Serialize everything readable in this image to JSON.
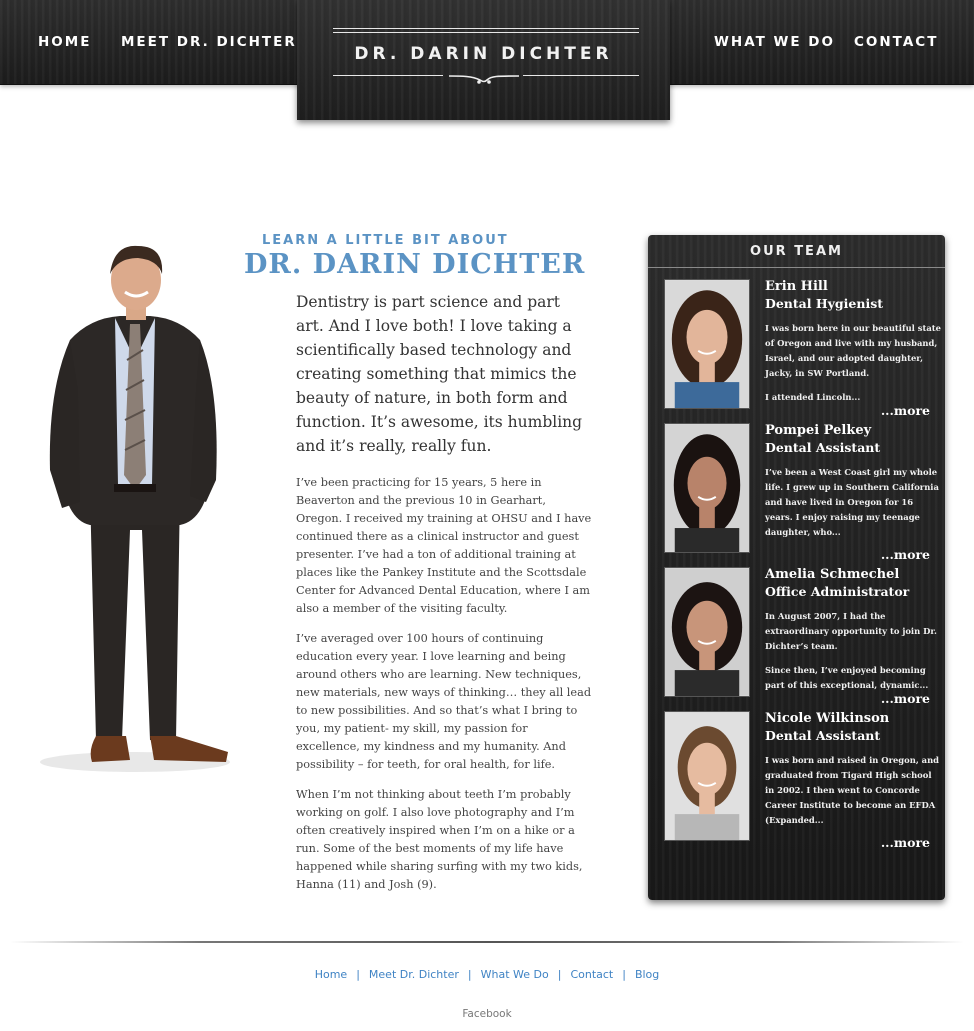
{
  "nav": {
    "home": "HOME",
    "meet": "MEET DR. DICHTER",
    "what": "WHAT WE DO",
    "contact": "CONTACT"
  },
  "logo": {
    "text": "DR. DARIN DICHTER"
  },
  "intro": {
    "eyebrow": "LEARN A LITTLE BIT ABOUT",
    "title": "DR. DARIN DICHTER",
    "lead": "Dentistry is part science and part art. And I love both! I love taking a scientifically based technology and creating something that mimics the beauty of nature, in both form and function. It’s awesome, its humbling and it’s really, really fun.",
    "paragraphs": [
      "I’ve been practicing for 15 years, 5 here in Beaverton and the previous 10 in Gearhart, Oregon. I received my training at OHSU and I have continued there as a clinical instructor and guest presenter. I’ve had a ton of additional training at places like the Pankey Institute and the Scottsdale Center for Advanced Dental Education, where I am also a member of the visiting faculty.",
      "I’ve averaged over 100 hours of continuing education every year. I love learning and being around others who are learning. New techniques, new materials, new ways of thinking… they all lead to new possibilities. And so that’s what I bring to you, my patient- my skill, my passion for excellence, my kindness and my humanity. And possibility – for teeth, for oral health, for life.",
      "When I’m not thinking about teeth I’m probably working on golf. I also love photography and I’m often creatively inspired when I’m on a hike or a run.  Some of the best moments of my life have happened while sharing surfing with my two kids, Hanna (11) and Josh (9)."
    ]
  },
  "team": {
    "heading": "OUR TEAM",
    "more_label": "...more",
    "members": [
      {
        "name": "Erin Hill",
        "role": "Dental Hygienist",
        "bio": [
          "I was born here in our beautiful state of Oregon and live with my husband, Israel, and our adopted daughter, Jacky, in SW Portland.",
          "I attended Lincoln..."
        ],
        "hair": "#3a2418",
        "skin": "#e2b59a",
        "shirt": "#3d6a9a"
      },
      {
        "name": "Pompei Pelkey",
        "role": "Dental Assistant",
        "bio": [
          "I’ve been a West Coast girl my whole life. I grew up in Southern California and have lived in Oregon for 16 years. I enjoy raising my teenage daughter, who..."
        ],
        "hair": "#1a1210",
        "skin": "#b8836a",
        "shirt": "#2a2a2a"
      },
      {
        "name": "Amelia Schmechel",
        "role": "Office Administrator",
        "bio": [
          "In August 2007, I had the extraordinary opportunity to join Dr. Dichter’s team.",
          "Since then, I’ve enjoyed becoming part of this exceptional, dynamic..."
        ],
        "hair": "#1c1412",
        "skin": "#c8957a",
        "shirt": "#2b2b2b"
      },
      {
        "name": "Nicole Wilkinson",
        "role": "Dental Assistant",
        "bio": [
          "I was born and raised in Oregon, and graduated from Tigard High school in 2002. I then went to Concorde Career Institute to become an EFDA (Expanded..."
        ],
        "hair": "#6b4a30",
        "skin": "#e6bba0",
        "shirt": "#b7b7b7"
      }
    ]
  },
  "footer": {
    "links": [
      "Home",
      "Meet Dr. Dichter",
      "What We Do",
      "Contact",
      "Blog"
    ],
    "social": "Facebook"
  },
  "colors": {
    "accent_blue": "#5b93c4",
    "footer_link": "#3f83c4",
    "dark_panel": "#222222"
  }
}
